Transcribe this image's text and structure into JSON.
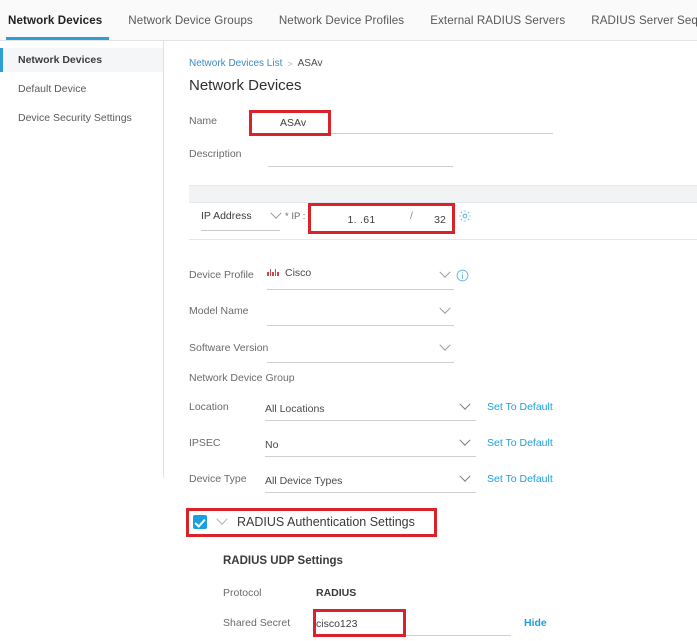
{
  "tabs": [
    {
      "label": "Network Devices",
      "active": true
    },
    {
      "label": "Network Device Groups",
      "active": false
    },
    {
      "label": "Network Device Profiles",
      "active": false
    },
    {
      "label": "External RADIUS Servers",
      "active": false
    },
    {
      "label": "RADIUS Server Sequences",
      "active": false
    }
  ],
  "sidebar": {
    "items": [
      {
        "label": "Network Devices",
        "active": true
      },
      {
        "label": "Default Device",
        "active": false
      },
      {
        "label": "Device Security Settings",
        "active": false
      }
    ]
  },
  "breadcrumb": {
    "parent": "Network Devices List",
    "separator": ">",
    "current": "ASAv"
  },
  "page": {
    "title": "Network Devices"
  },
  "form": {
    "name_label": "Name",
    "name_value": "ASAv",
    "description_label": "Description",
    "description_value": "",
    "ip_type_value": "IP Address",
    "ip_required_label": "* IP :",
    "ip_value": "1.      .61",
    "ip_separator": "/",
    "ip_mask": "32",
    "gear_icon": "gear-icon",
    "device_profile_label": "Device Profile",
    "device_profile_value": "Cisco",
    "device_profile_info_icon": "info-icon",
    "model_name_label": "Model Name",
    "model_name_value": "",
    "software_version_label": "Software Version",
    "software_version_value": ""
  },
  "device_group": {
    "heading": "Network Device Group",
    "rows": [
      {
        "label": "Location",
        "value": "All Locations",
        "action": "Set To Default"
      },
      {
        "label": "IPSEC",
        "value": "No",
        "action": "Set To Default"
      },
      {
        "label": "Device Type",
        "value": "All Device Types",
        "action": "Set To Default"
      }
    ]
  },
  "radius": {
    "section_title": "RADIUS Authentication Settings",
    "checked": true,
    "udp_heading": "RADIUS UDP Settings",
    "protocol_label": "Protocol",
    "protocol_value": "RADIUS",
    "shared_secret_label": "Shared Secret",
    "shared_secret_value": "cisco123",
    "hide_label": "Hide"
  },
  "colors": {
    "accent_blue": "#2e9fd4",
    "link_blue": "#1e9fd8",
    "annotation_red": "#d9232a",
    "checkbox_blue": "#1aa0e0",
    "cisco_red": "#c8484e"
  }
}
